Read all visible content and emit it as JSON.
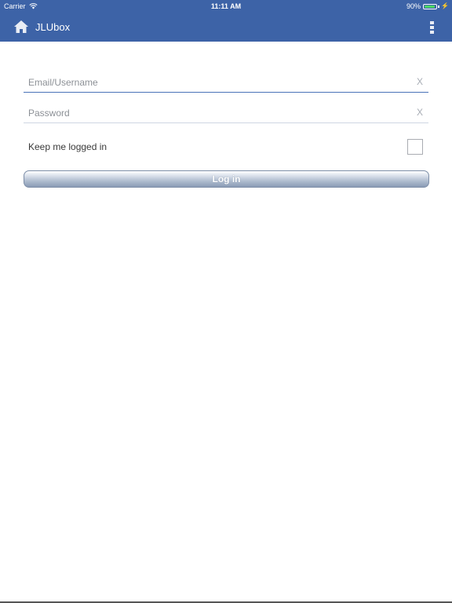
{
  "status_bar": {
    "carrier": "Carrier",
    "time": "11:11 AM",
    "battery_percent_text": "90%",
    "battery_level": 0.9,
    "wifi_icon": "wifi-icon",
    "charging_icon": "charging-bolt-icon",
    "background_color": "#3d63a7"
  },
  "nav": {
    "title": "JLUbox",
    "home_icon": "home-icon",
    "menu_icon": "more-vertical-icon",
    "background_color": "#3d63a7"
  },
  "form": {
    "email": {
      "placeholder": "Email/Username",
      "value": "",
      "clear_label": "X"
    },
    "password": {
      "placeholder": "Password",
      "value": "",
      "clear_label": "X"
    },
    "keep_logged_in": {
      "label": "Keep me logged in",
      "checked": false
    },
    "login_button_label": "Log in"
  }
}
